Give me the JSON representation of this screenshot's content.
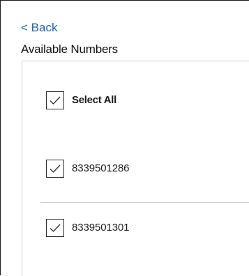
{
  "nav": {
    "back_label": "< Back"
  },
  "page": {
    "title": "Available Numbers"
  },
  "select_all": {
    "label": "Select All",
    "checked": true
  },
  "numbers": [
    {
      "value": "8339501286",
      "checked": true
    },
    {
      "value": "8339501301",
      "checked": true
    }
  ],
  "colors": {
    "link": "#1f63b5",
    "text": "#1c1c1c",
    "border": "#2b2b2b",
    "divider": "#d0d0d0"
  },
  "icons": {
    "checkmark": "check-icon"
  }
}
